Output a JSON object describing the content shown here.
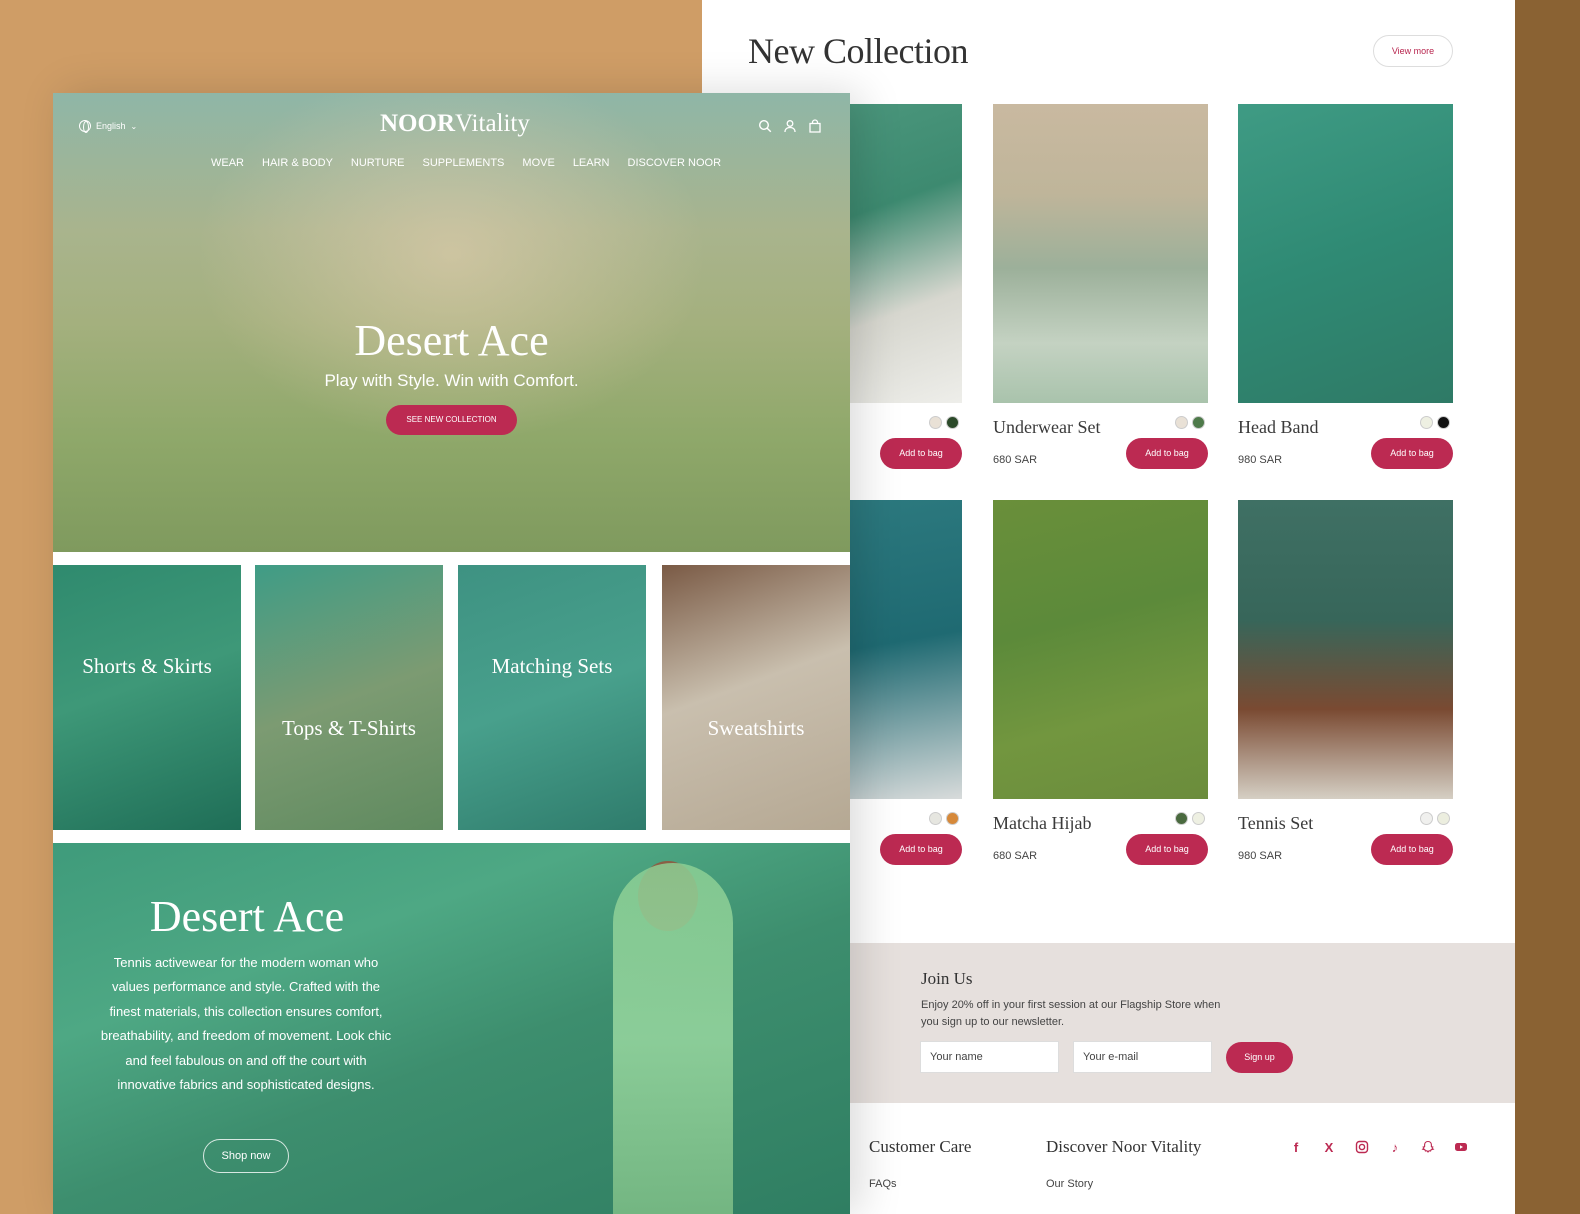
{
  "collection": {
    "title": "New Collection",
    "view_more": "View more",
    "products": [
      {
        "name": "",
        "price": "",
        "add": "Add to bag",
        "swatches": [
          "#e9e1d6",
          "#2c4a2a"
        ]
      },
      {
        "name": "Underwear Set",
        "price": "680 SAR",
        "add": "Add to bag",
        "swatches": [
          "#e9e1d6",
          "#4e7a4a"
        ]
      },
      {
        "name": "Head Band",
        "price": "980 SAR",
        "add": "Add to bag",
        "swatches": [
          "#eef0e2",
          "#111111"
        ]
      },
      {
        "name": "",
        "price": "",
        "add": "Add to bag",
        "swatches": [
          "#e6e6e0",
          "#d6893a"
        ]
      },
      {
        "name": "Matcha Hijab",
        "price": "680 SAR",
        "add": "Add to bag",
        "swatches": [
          "#4a6a3f",
          "#eef0e2"
        ]
      },
      {
        "name": "Tennis Set",
        "price": "980 SAR",
        "add": "Add to bag",
        "swatches": [
          "#f0f0ee",
          "#eceedf"
        ]
      }
    ]
  },
  "join": {
    "title": "Join Us",
    "text": "Enjoy 20% off in your first session at our Flagship Store when you sign up to our newsletter.",
    "name_placeholder": "Your name",
    "email_placeholder": "Your e-mail",
    "signup": "Sign up"
  },
  "footer": {
    "care_title": "Customer Care",
    "care_link": "FAQs",
    "discover_title": "Discover Noor Vitality",
    "discover_link": "Our Story",
    "social": [
      "facebook-icon",
      "x-icon",
      "instagram-icon",
      "tiktok-icon",
      "snapchat-icon",
      "youtube-icon"
    ]
  },
  "header": {
    "language": "English",
    "logo_bold": "NOOR",
    "logo_light": "Vitality",
    "nav": [
      "WEAR",
      "HAIR & BODY",
      "NURTURE",
      "SUPPLEMENTS",
      "MOVE",
      "LEARN",
      "DISCOVER NOOR"
    ]
  },
  "hero": {
    "title": "Desert Ace",
    "subtitle": "Play with Style. Win with Comfort.",
    "button": "SEE NEW COLLECTION"
  },
  "categories": [
    "Shorts & Skirts",
    "Tops & T-Shirts",
    "Matching Sets",
    "Sweatshirts"
  ],
  "banner": {
    "title": "Desert Ace",
    "text": "Tennis activewear for the modern woman who values performance and style. Crafted with the finest materials, this collection ensures comfort, breathability, and freedom of movement. Look chic and feel fabulous on and off the court with innovative fabrics and sophisticated designs.",
    "button": "Shop now"
  },
  "colors": {
    "accent": "#bc2a52",
    "background": "#cf9d66"
  }
}
